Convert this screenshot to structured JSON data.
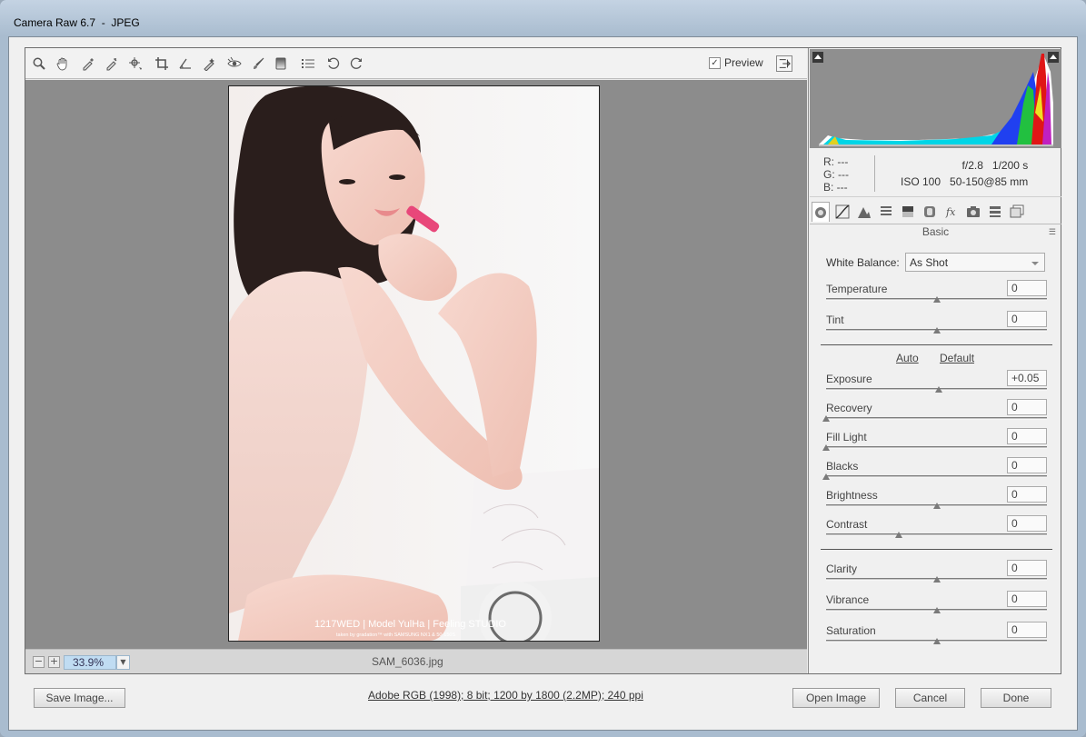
{
  "window": {
    "title": "Camera Raw 6.7  -  JPEG"
  },
  "toolbar": {
    "tools": [
      "zoom-tool",
      "hand-tool",
      "white-balance-tool",
      "color-sampler-tool",
      "targeted-adjustment-tool",
      "crop-tool",
      "straighten-tool",
      "spot-removal-tool",
      "red-eye-removal-tool",
      "adjustment-brush-tool",
      "graduated-filter-tool",
      "open-preferences-tool",
      "rotate-ccw-tool",
      "rotate-cw-tool"
    ],
    "preview_label": "Preview",
    "preview_checked": true
  },
  "statusbar": {
    "zoom": "33.9%",
    "filename": "SAM_6036.jpg"
  },
  "photo": {
    "watermark_line1": "1217WED | Model YulHa | Feeling STUDIO",
    "watermark_line2": "taken by gradation™ with SAMSUNG NX1 & 50-150S"
  },
  "info": {
    "r": "R:  ---",
    "g": "G:  ---",
    "b": "B:  ---",
    "aperture": "f/2.8",
    "shutter": "1/200 s",
    "iso": "ISO 100",
    "lens": "50-150@85 mm"
  },
  "panel": {
    "tabs": [
      "basic",
      "tone-curve",
      "detail",
      "hsl-grayscale",
      "split-toning",
      "lens-corrections",
      "effects",
      "camera-calibration",
      "presets",
      "snapshots"
    ],
    "title": "Basic",
    "white_balance_label": "White Balance:",
    "white_balance_value": "As Shot",
    "auto_label": "Auto",
    "default_label": "Default",
    "sliders": [
      {
        "label": "Temperature",
        "value": "0",
        "pos": 0.5
      },
      {
        "label": "Tint",
        "value": "0",
        "pos": 0.5
      },
      {
        "label": "Exposure",
        "value": "+0.05",
        "pos": 0.51
      },
      {
        "label": "Recovery",
        "value": "0",
        "pos": 0.0
      },
      {
        "label": "Fill Light",
        "value": "0",
        "pos": 0.0
      },
      {
        "label": "Blacks",
        "value": "0",
        "pos": 0.0
      },
      {
        "label": "Brightness",
        "value": "0",
        "pos": 0.5
      },
      {
        "label": "Contrast",
        "value": "0",
        "pos": 0.33
      },
      {
        "label": "Clarity",
        "value": "0",
        "pos": 0.5
      },
      {
        "label": "Vibrance",
        "value": "0",
        "pos": 0.5
      },
      {
        "label": "Saturation",
        "value": "0",
        "pos": 0.5
      }
    ]
  },
  "footer": {
    "save_label": "Save Image...",
    "file_info": "Adobe RGB (1998); 8 bit; 1200 by 1800 (2.2MP); 240 ppi",
    "open_label": "Open Image",
    "cancel_label": "Cancel",
    "done_label": "Done"
  }
}
